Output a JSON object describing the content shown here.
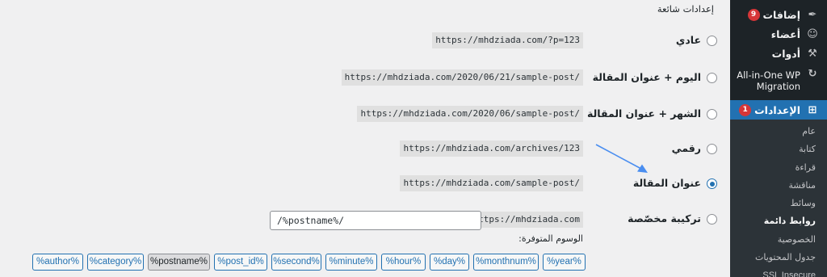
{
  "sidebar": {
    "items": [
      {
        "label": "إضافات",
        "icon": "plugin-icon",
        "badge": "9"
      },
      {
        "label": "أعضاء",
        "icon": "users-icon"
      },
      {
        "label": "أدوات",
        "icon": "tools-icon"
      },
      {
        "label": "All-in-One WP Migration",
        "icon": "migration-icon"
      },
      {
        "label": "الإعدادات",
        "icon": "settings-icon",
        "badge": "1"
      }
    ],
    "submenu": [
      "عام",
      "كتابة",
      "قراءة",
      "مناقشة",
      "وسائط",
      "روابط دائمة",
      "الخصوصية",
      "جدول المحتويات",
      "SSL Insecure Content"
    ],
    "active_submenu": "روابط دائمة"
  },
  "main": {
    "section_title": "إعدادات شائعة",
    "options": [
      {
        "label": "عادي",
        "example": "https://mhdziada.com/?p=123",
        "checked": false
      },
      {
        "label": "اليوم + عنوان المقالة",
        "example": "https://mhdziada.com/2020/06/21/sample-post/",
        "checked": false
      },
      {
        "label": "الشهر + عنوان المقالة",
        "example": "https://mhdziada.com/2020/06/sample-post/",
        "checked": false
      },
      {
        "label": "رقمي",
        "example": "https://mhdziada.com/archives/123",
        "checked": false
      },
      {
        "label": "عنوان المقالة",
        "example": "https://mhdziada.com/sample-post/",
        "checked": true
      },
      {
        "label": "تركيبة مخصّصة",
        "example": "https://mhdziada.com",
        "checked": false
      }
    ],
    "custom_value": "/%postname%/",
    "tags_label": "الوسوم المتوفرة:",
    "tags": [
      "%year%",
      "%monthnum%",
      "%day%",
      "%hour%",
      "%minute%",
      "%second%",
      "%post_id%",
      "%postname%",
      "%category%",
      "%author%"
    ],
    "pressed_tag": "%postname%"
  },
  "colors": {
    "accent": "#2271b1",
    "sidebar_bg": "#1d2327",
    "badge": "#d63638",
    "arrow": "#4a8ef0"
  }
}
